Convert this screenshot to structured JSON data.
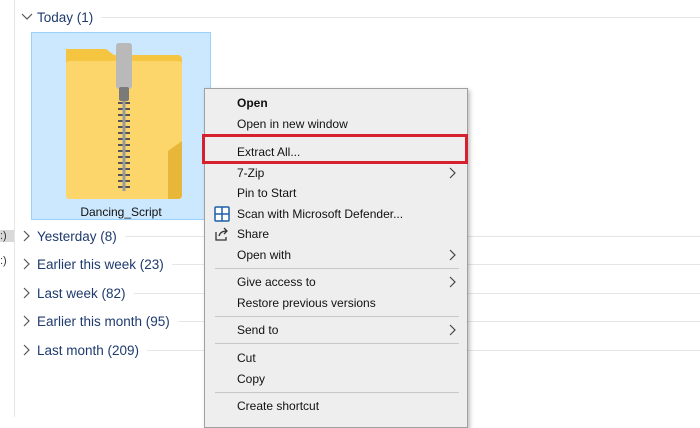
{
  "nav": {
    "fragments": [
      ":)",
      ":)"
    ]
  },
  "groups": {
    "today": "Today (1)",
    "yesterday": "Yesterday (8)",
    "earlier_this_week": "Earlier this week (23)",
    "last_week": "Last week (82)",
    "earlier_this_month": "Earlier this month (95)",
    "last_month": "Last month (209)"
  },
  "file": {
    "name": "Dancing_Script",
    "icon": "zip-folder-icon"
  },
  "menu": {
    "open": "Open",
    "open_new_window": "Open in new window",
    "extract_all": "Extract All...",
    "seven_zip": "7-Zip",
    "pin_to_start": "Pin to Start",
    "scan_defender": "Scan with Microsoft Defender...",
    "share": "Share",
    "open_with": "Open with",
    "give_access": "Give access to",
    "restore_versions": "Restore previous versions",
    "send_to": "Send to",
    "cut": "Cut",
    "copy": "Copy",
    "create_shortcut": "Create shortcut"
  },
  "colors": {
    "selection": "#cce8ff",
    "highlight_border": "#d7202e",
    "group_text": "#1e3a6e",
    "menu_bg": "#eeeeee"
  }
}
